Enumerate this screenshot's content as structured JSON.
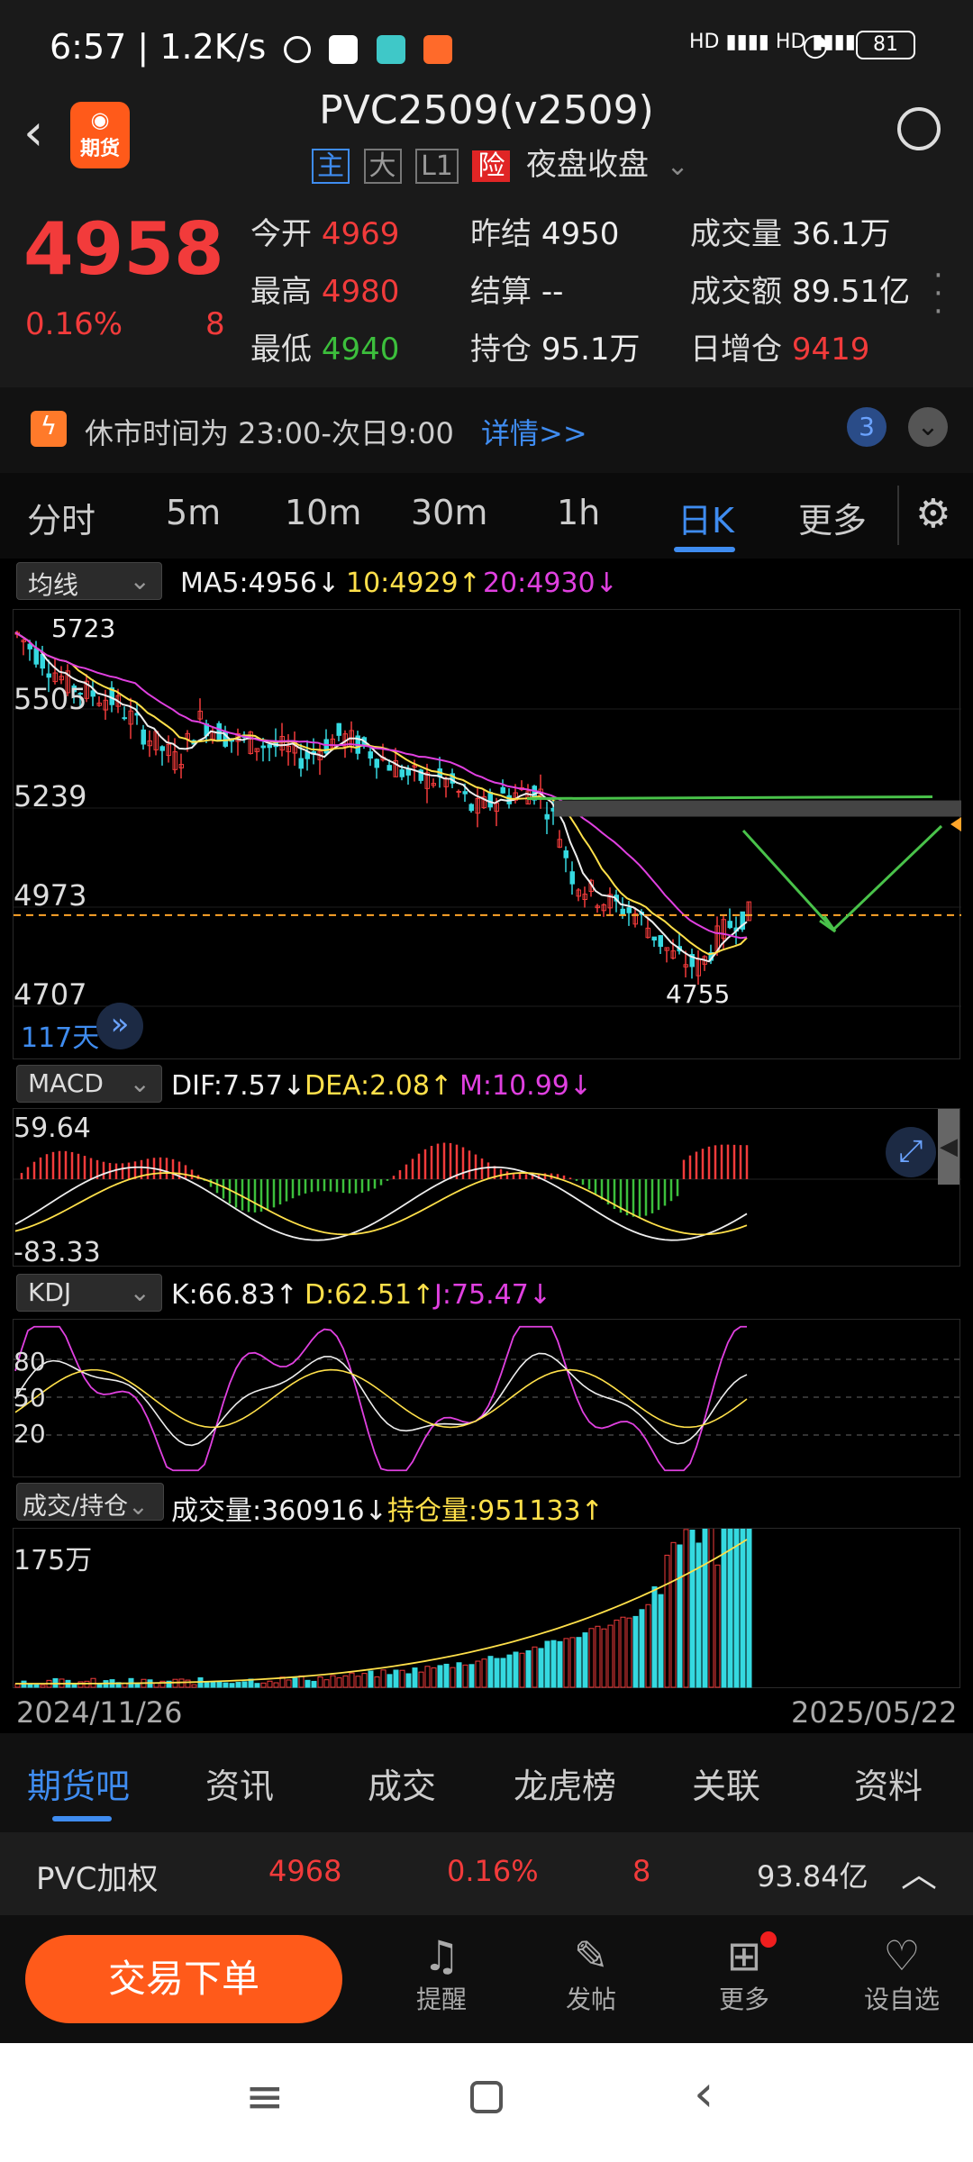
{
  "status_bar": {
    "time": "6:57",
    "speed": "1.2K/s",
    "battery": "81"
  },
  "header": {
    "title": "PVC2509(v2509)",
    "logo_text": "期货",
    "badges": [
      "主",
      "大",
      "L1",
      "险"
    ],
    "subtitle": "夜盘收盘"
  },
  "quote": {
    "price": "4958",
    "change_pct": "0.16%",
    "change": "8",
    "open_label": "今开",
    "open": "4969",
    "high_label": "最高",
    "high": "4980",
    "low_label": "最低",
    "low": "4940",
    "prev_label": "昨结",
    "prev": "4950",
    "settle_label": "结算",
    "settle": "--",
    "oi_label": "持仓",
    "oi": "95.1万",
    "vol_label": "成交量",
    "vol": "36.1万",
    "amt_label": "成交额",
    "amt": "89.51亿",
    "daily_oi_label": "日增仓",
    "daily_oi": "9419"
  },
  "notice": {
    "text": "休市时间为 23:00-次日9:00",
    "link": "详情>>",
    "count": "3"
  },
  "tabs": [
    "分时",
    "5m",
    "10m",
    "30m",
    "1h",
    "日K",
    "更多"
  ],
  "ma": {
    "select": "均线",
    "ma5": "MA5:4956↓",
    "ma10": "10:4929↑",
    "ma20": "20:4930↓"
  },
  "kline": {
    "ylabels": [
      "5505",
      "5239",
      "4973",
      "4707"
    ],
    "top_label": "5723",
    "low_label": "4755",
    "days": "117天"
  },
  "macd": {
    "select": "MACD",
    "dif": "DIF:7.57↓",
    "dea": "DEA:2.08↑",
    "m": "M:10.99↓",
    "ylabels": [
      "59.64",
      "-83.33"
    ]
  },
  "kdj": {
    "select": "KDJ",
    "k": "K:66.83↑",
    "d": "D:62.51↑",
    "j": "J:75.47↓",
    "ylabels": [
      "80",
      "50",
      "20"
    ]
  },
  "volume": {
    "select": "成交/持仓",
    "vol": "成交量:360916↓",
    "oi": "持仓量:951133↑",
    "ylabel": "175万",
    "date_start": "2024/11/26",
    "date_end": "2025/05/22"
  },
  "bottom_tabs": [
    "期货吧",
    "资讯",
    "成交",
    "龙虎榜",
    "关联",
    "资料"
  ],
  "info_bar": {
    "name": "PVC加权",
    "price": "4968",
    "pct": "0.16%",
    "chg": "8",
    "amount": "93.84亿"
  },
  "action": {
    "trade": "交易下单",
    "items": [
      "提醒",
      "发帖",
      "更多",
      "设自选"
    ]
  },
  "colors": {
    "up": "#f23b3b",
    "down": "#3cbf3c",
    "accent": "#3f8cf0",
    "trade": "#ff5a1a",
    "yellow": "#ffe04a",
    "magenta": "#e040e0",
    "cyan": "#35d9e0"
  }
}
